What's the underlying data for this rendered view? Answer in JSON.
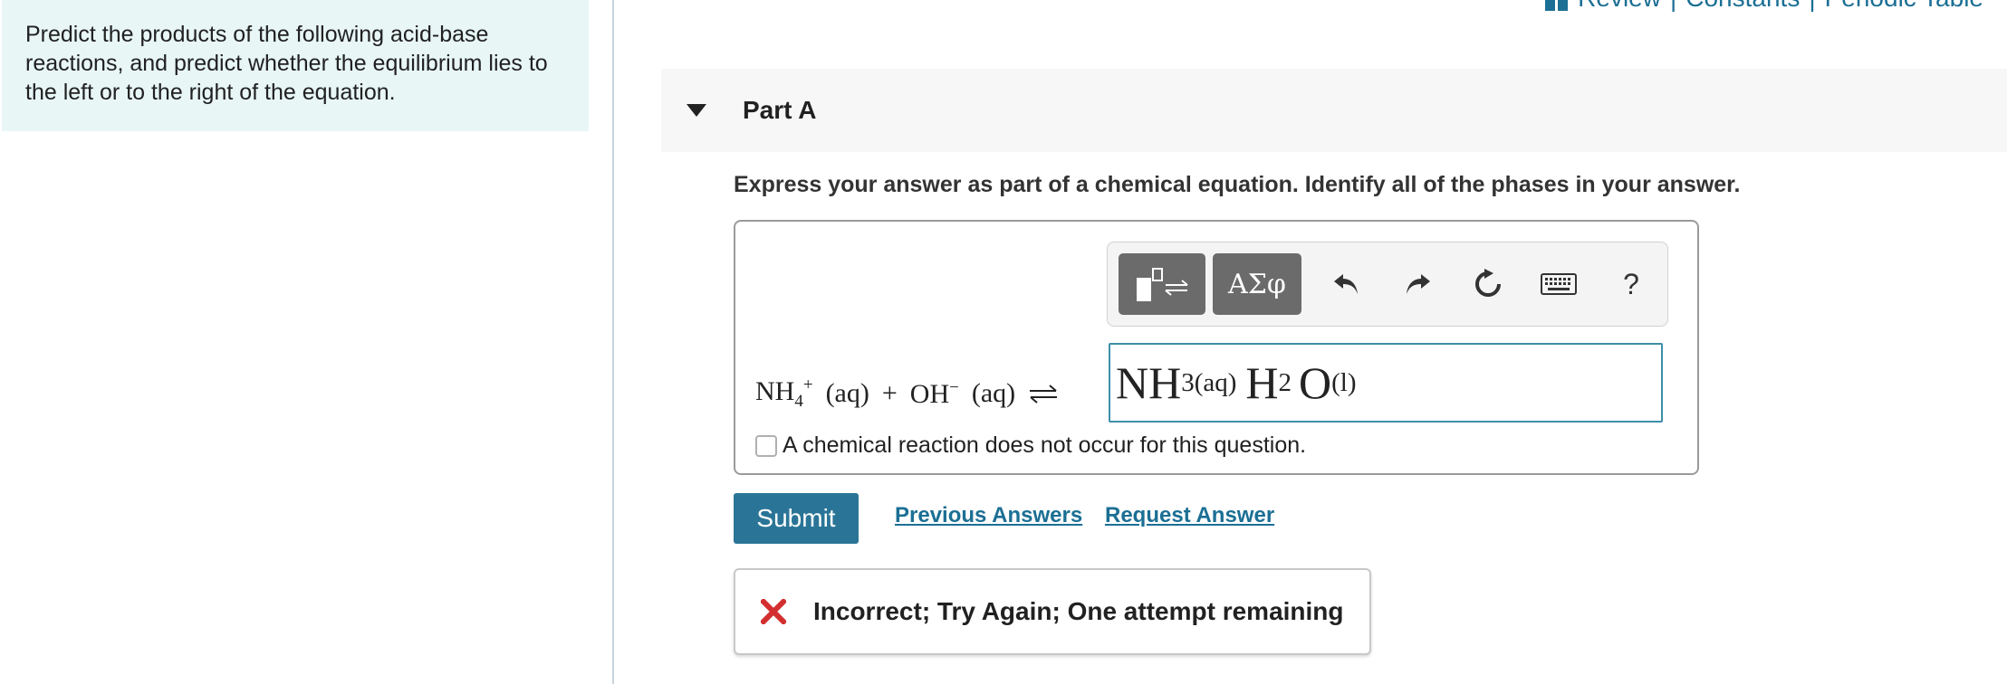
{
  "intro": {
    "text": "Predict the products of the following acid-base reactions, and predict whether the equilibrium lies to the left or to the right of the equation."
  },
  "top_links": {
    "review": "Review",
    "sep1": " | ",
    "constants": "Constants",
    "sep2": " | ",
    "periodic_table": "Periodic Table",
    "icon": "book-icon"
  },
  "part": {
    "title": "Part A",
    "caret_icon": "caret-down-icon"
  },
  "instruction": "Express your answer as part of a chemical equation. Identify all of the phases in your answer.",
  "toolbar": {
    "templates_icon": "templates-icon",
    "greek_label": "ΑΣφ",
    "undo_icon": "undo-icon",
    "redo_icon": "redo-icon",
    "reset_icon": "reset-icon",
    "keyboard_icon": "keyboard-icon",
    "help_label": "?"
  },
  "equation": {
    "reactant1": "NH",
    "reactant1_sub": "4",
    "reactant1_sup": "+",
    "reactant1_phase": "(aq)",
    "plus": "+",
    "reactant2": "OH",
    "reactant2_sup": "−",
    "reactant2_phase": "(aq)"
  },
  "answer": {
    "p1": "NH",
    "p1_sub": "3(aq)",
    "p2": "H",
    "p2_sub": "2",
    "p3": "O",
    "p3_sub": "(l)"
  },
  "no_reaction_label": "A chemical reaction does not occur for this question.",
  "actions": {
    "submit": "Submit",
    "previous_answers": "Previous Answers",
    "request_answer": "Request Answer"
  },
  "feedback": {
    "text": "Incorrect; Try Again; One attempt remaining",
    "icon": "x-icon",
    "color": "#d32f2f"
  },
  "colors": {
    "accent": "#2a7597",
    "link": "#1b6f94",
    "intro_bg": "#e8f6f6"
  }
}
